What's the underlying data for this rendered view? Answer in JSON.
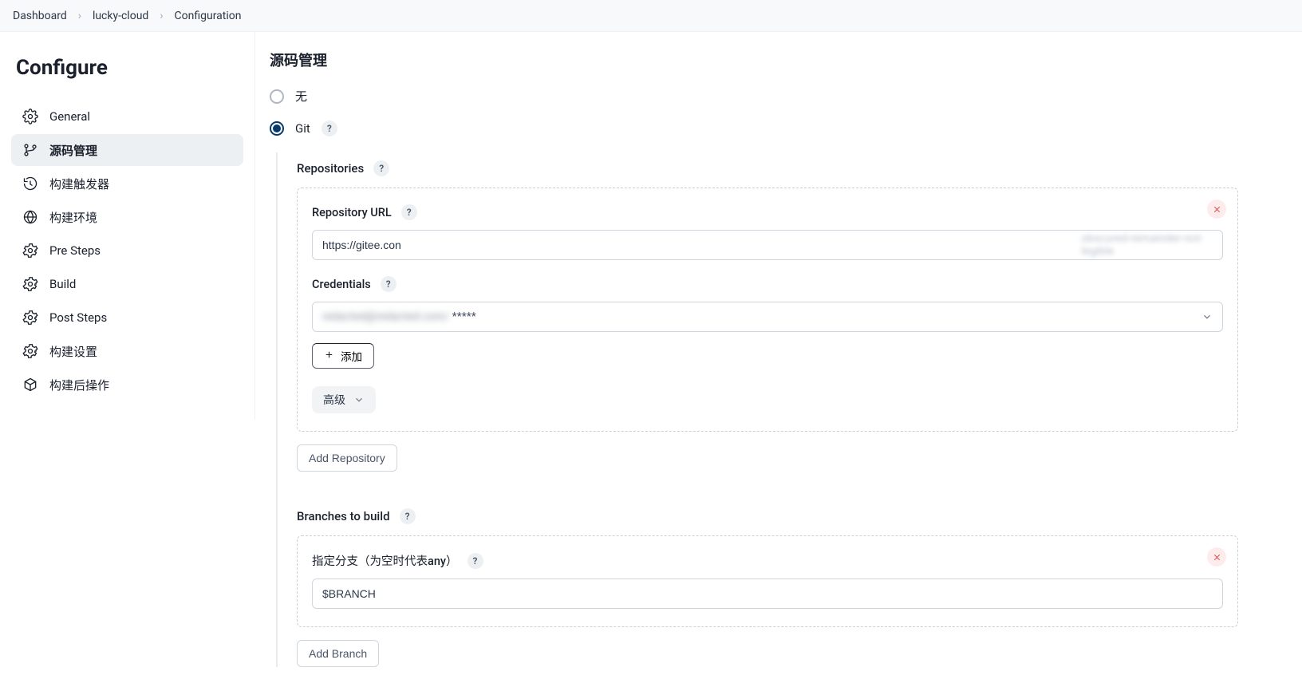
{
  "breadcrumb": {
    "items": [
      "Dashboard",
      "lucky-cloud",
      "Configuration"
    ]
  },
  "sidebar": {
    "title": "Configure",
    "items": [
      {
        "label": "General"
      },
      {
        "label": "源码管理"
      },
      {
        "label": "构建触发器"
      },
      {
        "label": "构建环境"
      },
      {
        "label": "Pre Steps"
      },
      {
        "label": "Build"
      },
      {
        "label": "Post Steps"
      },
      {
        "label": "构建设置"
      },
      {
        "label": "构建后操作"
      }
    ]
  },
  "scm": {
    "heading": "源码管理",
    "none_label": "无",
    "git_label": "Git",
    "repositories": {
      "label": "Repositories",
      "repo_url_label": "Repository URL",
      "repo_url_visible": "https://gitee.con",
      "repo_url_obscured": "obscured-remainder-not-legible",
      "credentials_label": "Credentials",
      "credentials_value_obscured": "redacted@redacted.com/",
      "credentials_value_suffix": "*****",
      "add_cred_label": "添加",
      "advanced_label": "高级",
      "add_repo_label": "Add Repository"
    },
    "branches": {
      "label": "Branches to build",
      "spec_label": "指定分支（为空时代表any）",
      "value": "$BRANCH",
      "add_branch_label": "Add Branch"
    }
  }
}
